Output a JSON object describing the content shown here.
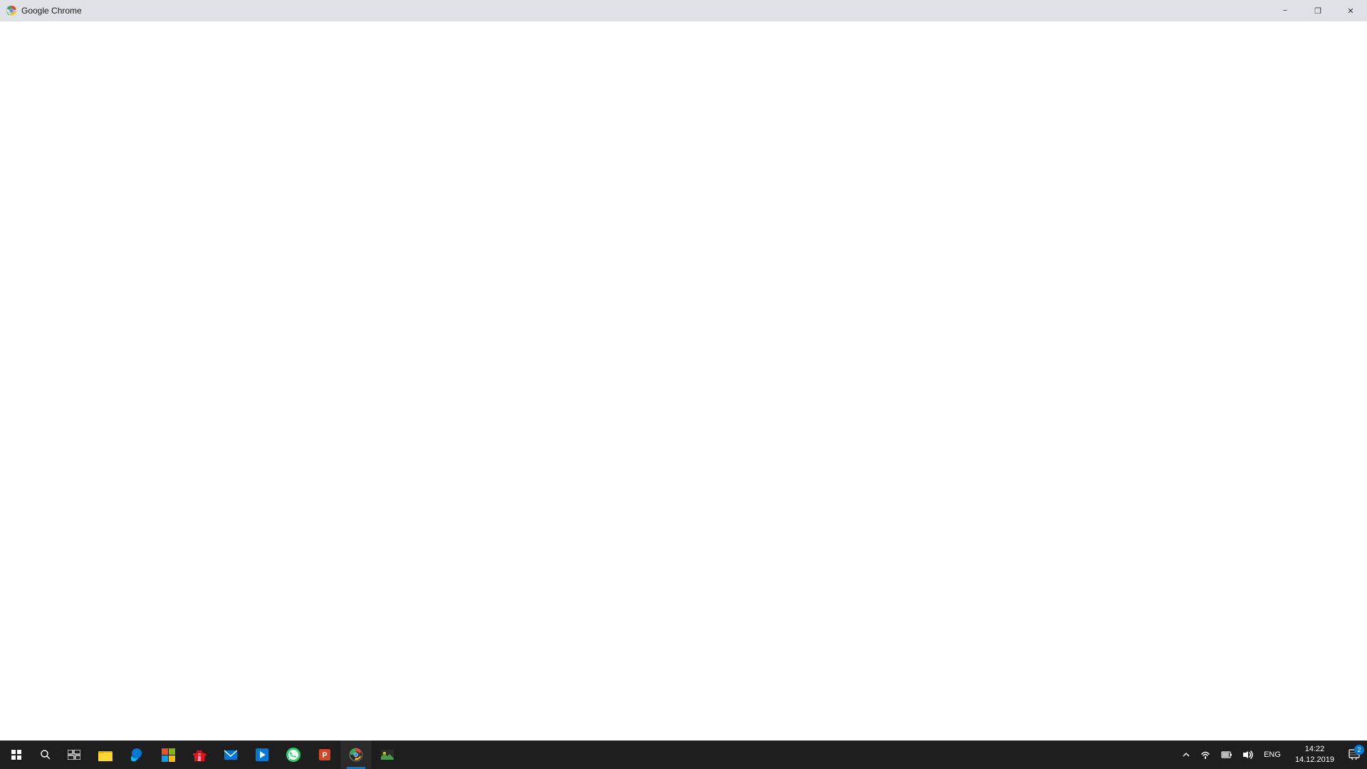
{
  "titlebar": {
    "title": "Google Chrome",
    "minimize_label": "−",
    "restore_label": "❐",
    "close_label": "✕"
  },
  "taskbar": {
    "apps": [
      {
        "name": "file-explorer",
        "label": "📁",
        "active": false,
        "icon": "folder"
      },
      {
        "name": "edge",
        "label": "e",
        "active": false,
        "icon": "edge"
      },
      {
        "name": "store",
        "label": "🛍",
        "active": false,
        "icon": "store"
      },
      {
        "name": "gift",
        "label": "🎁",
        "active": false,
        "icon": "gift"
      },
      {
        "name": "mail",
        "label": "✉",
        "active": false,
        "icon": "mail"
      },
      {
        "name": "media",
        "label": "▶",
        "active": false,
        "icon": "media"
      },
      {
        "name": "whatsapp",
        "label": "W",
        "active": false,
        "icon": "whatsapp"
      },
      {
        "name": "powerpoint",
        "label": "P",
        "active": false,
        "icon": "powerpoint"
      },
      {
        "name": "chrome",
        "label": "C",
        "active": true,
        "icon": "chrome"
      },
      {
        "name": "photos",
        "label": "🖼",
        "active": false,
        "icon": "photos"
      }
    ],
    "systray": {
      "chevron": "^",
      "wifi": "wifi",
      "battery": "battery",
      "volume": "volume",
      "language": "ENG"
    },
    "clock": {
      "time": "14:22",
      "date": "14.12.2019"
    },
    "notification_count": "2"
  }
}
